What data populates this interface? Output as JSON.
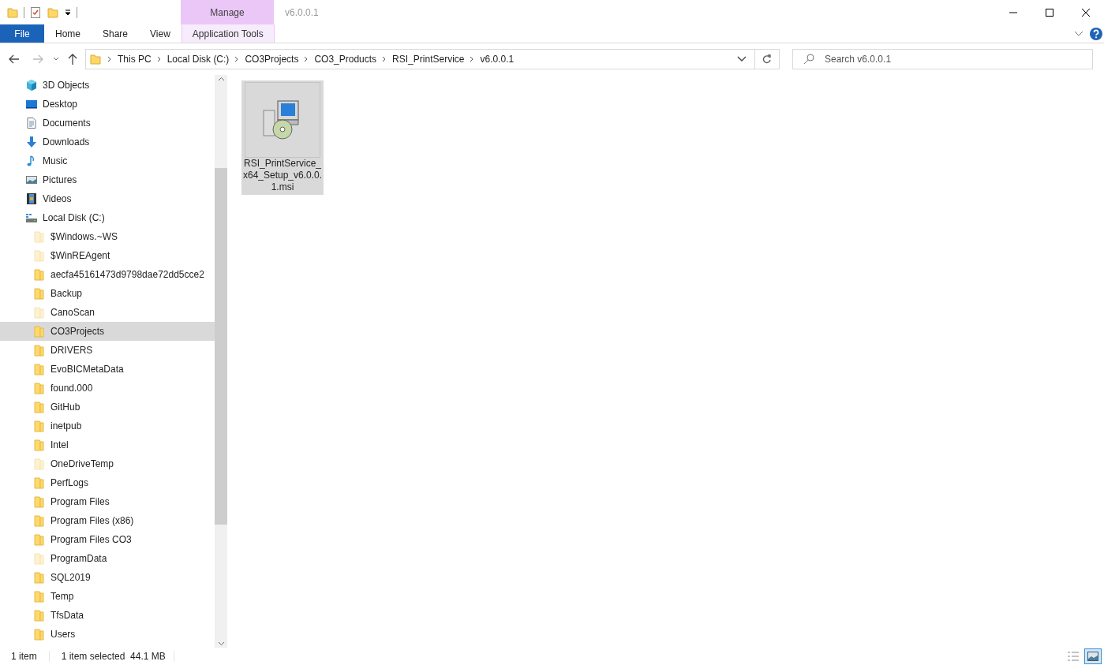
{
  "window": {
    "title": "v6.0.0.1"
  },
  "context_tab": {
    "group": "Manage",
    "label": "Application Tools",
    "selected": false
  },
  "ribbon_tabs": [
    {
      "label": "File",
      "kind": "file",
      "selected": false
    },
    {
      "label": "Home",
      "kind": "tab",
      "selected": false
    },
    {
      "label": "Share",
      "kind": "tab",
      "selected": false
    },
    {
      "label": "View",
      "kind": "tab",
      "selected": false
    }
  ],
  "address_bar": {
    "path": [
      "This PC",
      "Local Disk (C:)",
      "CO3Projects",
      "CO3_Products",
      "RSI_PrintService",
      "v6.0.0.1"
    ]
  },
  "search": {
    "placeholder": "Search v6.0.0.1"
  },
  "sidebar": {
    "items": [
      {
        "label": "3D Objects",
        "kind": "cube",
        "selected": false
      },
      {
        "label": "Desktop",
        "kind": "desktop",
        "selected": false
      },
      {
        "label": "Documents",
        "kind": "document",
        "selected": false
      },
      {
        "label": "Downloads",
        "kind": "download",
        "selected": false
      },
      {
        "label": "Music",
        "kind": "music",
        "selected": false
      },
      {
        "label": "Pictures",
        "kind": "picture",
        "selected": false
      },
      {
        "label": "Videos",
        "kind": "video",
        "selected": false
      },
      {
        "label": "Local Disk (C:)",
        "kind": "drive",
        "selected": false,
        "children": [
          {
            "label": "$Windows.~WS",
            "kind": "folder",
            "hidden": true,
            "selected": false
          },
          {
            "label": "$WinREAgent",
            "kind": "folder",
            "hidden": true,
            "selected": false
          },
          {
            "label": "aecfa45161473d9798dae72dd5cce2",
            "kind": "folder",
            "hidden": false,
            "selected": false
          },
          {
            "label": "Backup",
            "kind": "folder",
            "hidden": false,
            "selected": false
          },
          {
            "label": "CanoScan",
            "kind": "folder",
            "hidden": true,
            "selected": false
          },
          {
            "label": "CO3Projects",
            "kind": "folder",
            "hidden": false,
            "selected": true
          },
          {
            "label": "DRIVERS",
            "kind": "folder",
            "hidden": false,
            "selected": false
          },
          {
            "label": "EvoBICMetaData",
            "kind": "folder",
            "hidden": false,
            "selected": false
          },
          {
            "label": "found.000",
            "kind": "folder",
            "hidden": false,
            "selected": false
          },
          {
            "label": "GitHub",
            "kind": "folder",
            "hidden": false,
            "selected": false
          },
          {
            "label": "inetpub",
            "kind": "folder",
            "hidden": false,
            "selected": false
          },
          {
            "label": "Intel",
            "kind": "folder",
            "hidden": false,
            "selected": false
          },
          {
            "label": "OneDriveTemp",
            "kind": "folder",
            "hidden": true,
            "selected": false
          },
          {
            "label": "PerfLogs",
            "kind": "folder",
            "hidden": false,
            "selected": false
          },
          {
            "label": "Program Files",
            "kind": "folder",
            "hidden": false,
            "selected": false
          },
          {
            "label": "Program Files (x86)",
            "kind": "folder",
            "hidden": false,
            "selected": false
          },
          {
            "label": "Program Files CO3",
            "kind": "folder",
            "hidden": false,
            "selected": false
          },
          {
            "label": "ProgramData",
            "kind": "folder",
            "hidden": true,
            "selected": false
          },
          {
            "label": "SQL2019",
            "kind": "folder",
            "hidden": false,
            "selected": false
          },
          {
            "label": "Temp",
            "kind": "folder",
            "hidden": false,
            "selected": false
          },
          {
            "label": "TfsData",
            "kind": "folder",
            "hidden": false,
            "selected": false
          },
          {
            "label": "Users",
            "kind": "folder",
            "hidden": false,
            "selected": false
          }
        ]
      }
    ]
  },
  "files": [
    {
      "name": "RSI_PrintService_ x64_Setup_v6.0.0. 1.msi",
      "selected": true
    }
  ],
  "status_bar": {
    "count": "1 item",
    "selection": "1 item selected  44.1 MB"
  },
  "view_buttons": [
    {
      "kind": "details",
      "selected": false
    },
    {
      "kind": "large_icons",
      "selected": true
    }
  ]
}
